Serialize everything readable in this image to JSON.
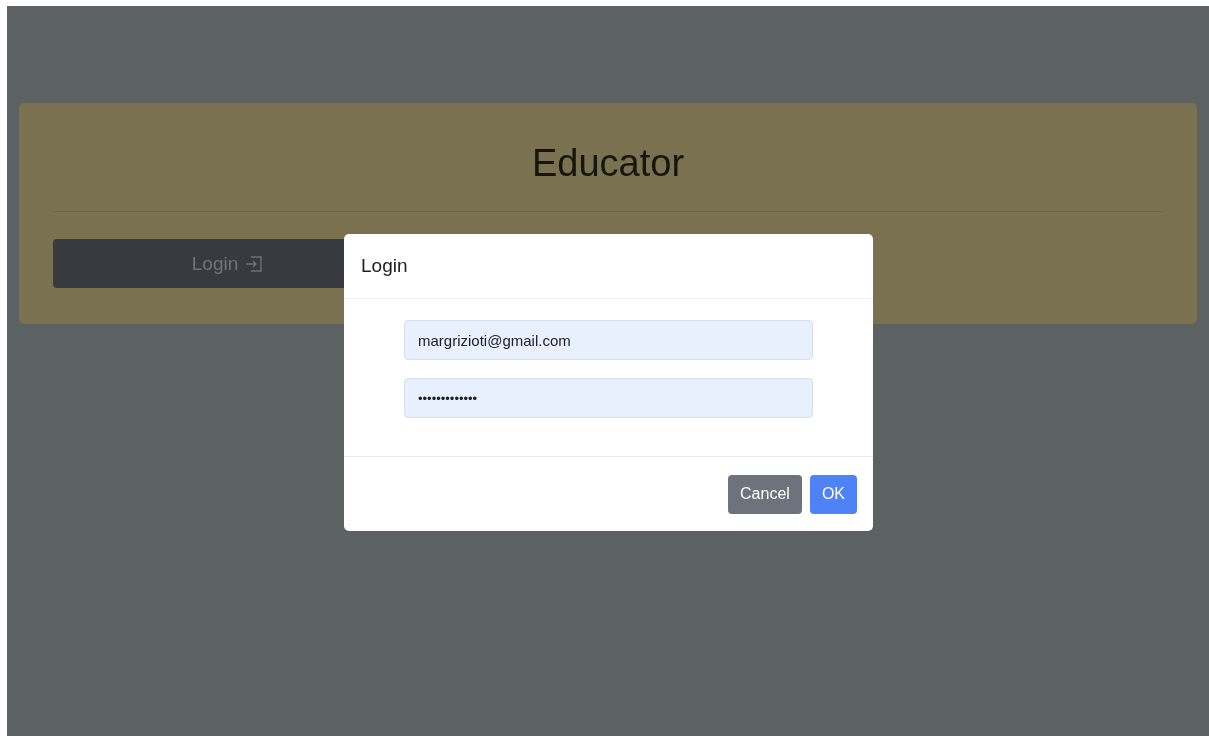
{
  "page": {
    "title": "Educator",
    "login_button": "Login"
  },
  "dialog": {
    "title": "Login",
    "fields": [
      {
        "kind": "email",
        "value": "margrizioti@gmail.com"
      },
      {
        "kind": "password",
        "value": "•••••••••••••"
      }
    ],
    "buttons": [
      {
        "label": "Cancel",
        "kind": "secondary"
      },
      {
        "label": "OK",
        "kind": "primary"
      }
    ]
  }
}
